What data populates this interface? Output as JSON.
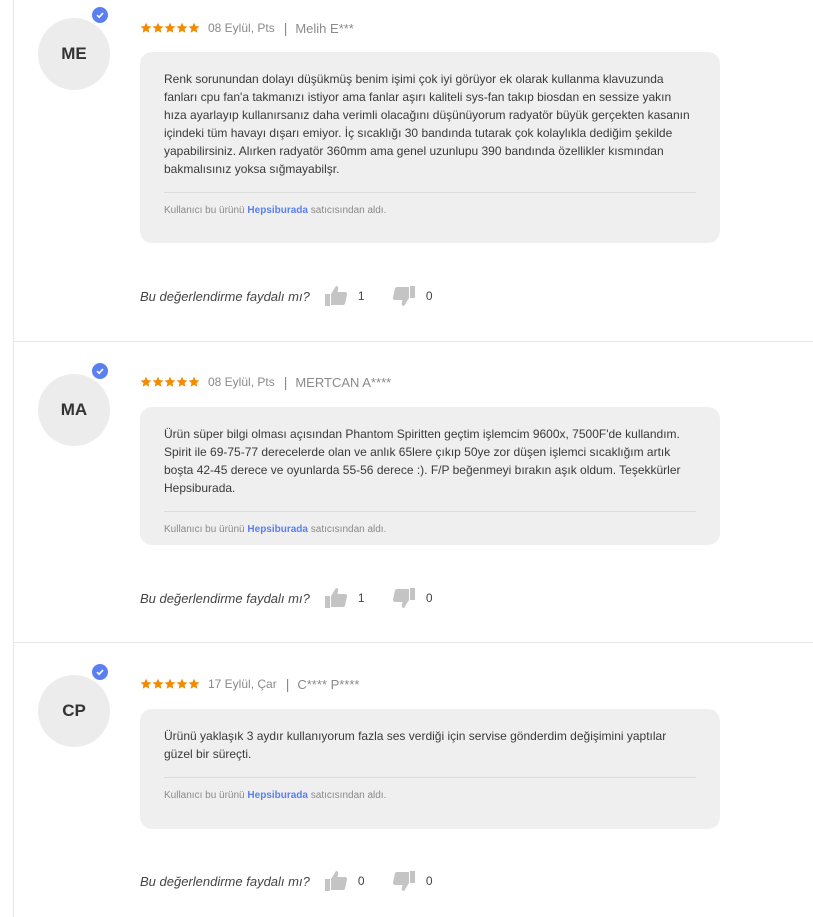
{
  "reviews": [
    {
      "initials": "ME",
      "rating": 5,
      "date": "08 Eylül, Pts",
      "author": "Melih E***",
      "text": "Renk sorunundan dolayı düşükmüş benim işimi çok iyi görüyor ek olarak kullanma klavuzunda fanları cpu fan'a takmanızı istiyor ama fanlar aşırı kaliteli sys-fan takıp biosdan en sessize yakın hıza ayarlayıp kullanırsanız daha verimli olacağını düşünüyorum radyatör büyük gerçekten kasanın içindeki tüm havayı dışarı emiyor. İç sıcaklığı 30 bandında tutarak çok kolaylıkla dediğim şekilde yapabilirsiniz. Alırken radyatör 360mm ama genel uzunlupu 390 bandında özellikler kısmından bakmalısınız yoksa sığmayabilşr.",
      "seller_prefix": "Kullanıcı bu ürünü",
      "seller_name": "Hepsiburada",
      "seller_suffix": "satıcısından aldı.",
      "helpful_question": "Bu değerlendirme faydalı mı?",
      "likes": "1",
      "dislikes": "0"
    },
    {
      "initials": "MA",
      "rating": 5,
      "date": "08 Eylül, Pts",
      "author": "MERTCAN A****",
      "text": "Ürün süper bilgi olması açısından Phantom Spiritten geçtim işlemcim 9600x, 7500F'de kullandım. Spirit ile 69-75-77 derecelerde olan ve anlık 65lere çıkıp 50ye zor düşen işlemci sıcaklığım artık boşta 42-45 derece ve oyunlarda 55-56 derece :). F/P beğenmeyi bırakın aşık oldum. Teşekkürler Hepsiburada.",
      "seller_prefix": "Kullanıcı bu ürünü",
      "seller_name": "Hepsiburada",
      "seller_suffix": "satıcısından aldı.",
      "helpful_question": "Bu değerlendirme faydalı mı?",
      "likes": "1",
      "dislikes": "0"
    },
    {
      "initials": "CP",
      "rating": 5,
      "date": "17 Eylül, Çar",
      "author": "C**** P****",
      "text": "Ürünü yaklaşık 3 aydır kullanıyorum fazla ses verdiği için servise gönderdim değişimini yaptılar güzel bir süreçti.",
      "seller_prefix": "Kullanıcı bu ürünü",
      "seller_name": "Hepsiburada",
      "seller_suffix": "satıcısından aldı.",
      "helpful_question": "Bu değerlendirme faydalı mı?",
      "likes": "0",
      "dislikes": "0"
    }
  ],
  "colors": {
    "star": "#f28b00",
    "verified": "#5a7ff0",
    "seller": "#5a7ff0",
    "bubble": "#efefef"
  },
  "icons": {
    "star": "star-icon",
    "verified": "verified-check-icon",
    "like": "thumbs-up-icon",
    "dislike": "thumbs-down-icon"
  }
}
